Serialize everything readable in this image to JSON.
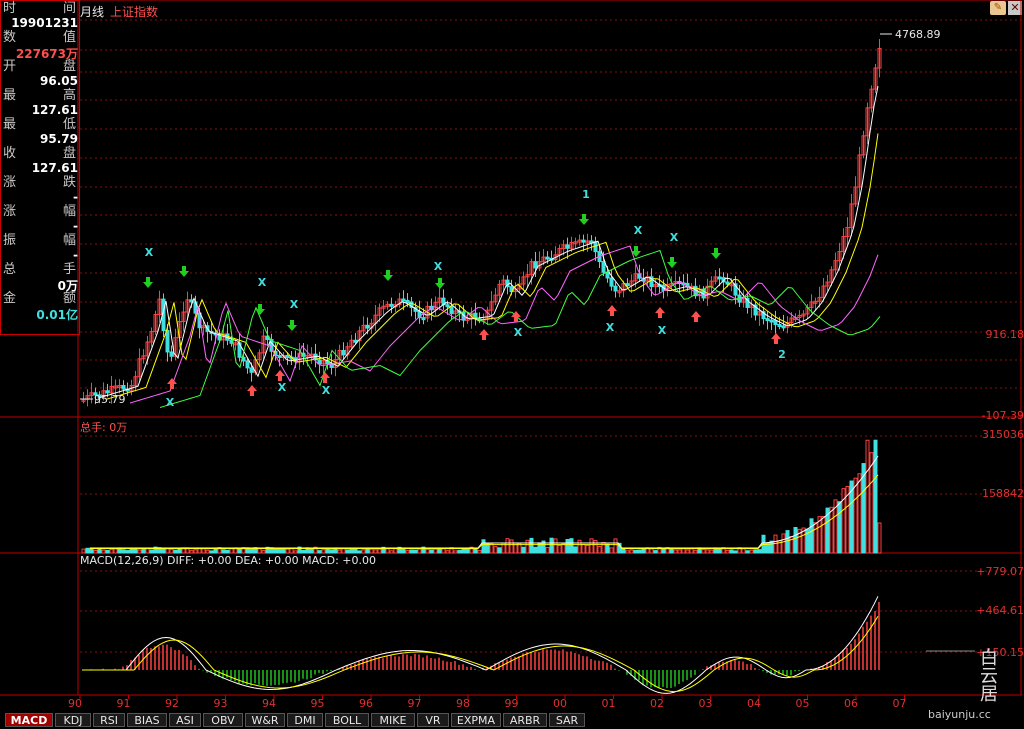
{
  "header": {
    "period": "月线",
    "index_name": "上证指数"
  },
  "info_panel": [
    {
      "left": "时",
      "right": "间",
      "value": "19901231"
    },
    {
      "left": "数",
      "right": "值",
      "value": "227673万",
      "value_color": "#ff5050"
    },
    {
      "left": "开",
      "right": "盘",
      "value": "96.05"
    },
    {
      "left": "最",
      "right": "高",
      "value": "127.61"
    },
    {
      "left": "最",
      "right": "低",
      "value": "95.79"
    },
    {
      "left": "收",
      "right": "盘",
      "value": "127.61"
    },
    {
      "left": "涨",
      "right": "跌",
      "value": "-"
    },
    {
      "left": "涨",
      "right": "幅",
      "value": "-"
    },
    {
      "left": "振",
      "right": "幅",
      "value": "-"
    },
    {
      "left": "总",
      "right": "手",
      "value": "0万"
    },
    {
      "left": "金",
      "right": "额",
      "value": "0.01亿"
    }
  ],
  "price_axis": {
    "high_label": "4768.89",
    "low_label": "95.79",
    "mid_label": "916.18",
    "bottom_label": "-107.39"
  },
  "volume_panel": {
    "title": "总手: 0万",
    "labels": [
      "315036",
      "158842"
    ]
  },
  "macd_panel": {
    "title": "MACD(12,26,9) DIFF: +0.00 DEA: +0.00 MACD: +0.00",
    "labels": [
      "+779.07",
      "+464.61",
      "+150.15"
    ]
  },
  "x_axis": [
    "90",
    "91",
    "92",
    "93",
    "94",
    "95",
    "96",
    "97",
    "98",
    "99",
    "00",
    "01",
    "02",
    "03",
    "04",
    "05",
    "06",
    "07"
  ],
  "annotations": {
    "cross": "X",
    "peak_label": "1",
    "trough_label": "2"
  },
  "tabs": [
    "MACD",
    "KDJ",
    "RSI",
    "BIAS",
    "ASI",
    "OBV",
    "W&R",
    "DMI",
    "BOLL",
    "MIKE",
    "VR",
    "EXPMA",
    "ARBR",
    "SAR"
  ],
  "watermark": {
    "text": "白云居",
    "url": "baiyunju.cc"
  },
  "colors": {
    "up": "#ff4040",
    "down": "#40e0e0",
    "grid": "#8a1010",
    "axis": "#e03030",
    "ma5": "#ffffff",
    "ma10": "#ffff00",
    "ma20": "#ff66ff",
    "ma60": "#40ff40"
  },
  "chart_data": {
    "type": "candlestick",
    "x": [
      "1990",
      "1991",
      "1992",
      "1993",
      "1994",
      "1995",
      "1996",
      "1997",
      "1998",
      "1999",
      "2000",
      "2001",
      "2002",
      "2003",
      "2004",
      "2005",
      "2006",
      "2007"
    ],
    "close": [
      127.61,
      292.75,
      780.39,
      833.8,
      647.87,
      555.29,
      917.02,
      1194.1,
      1146.7,
      1366.58,
      2073.48,
      1645.97,
      1357.65,
      1497.04,
      1266.5,
      1161.06,
      2675.47,
      4768.89
    ],
    "high": [
      127.61,
      292.75,
      1429.01,
      1558.95,
      1052.94,
      926.41,
      1258.69,
      1510.18,
      1422.98,
      1756.18,
      2125.72,
      2245.43,
      1748.89,
      1649.6,
      1783.01,
      1328.53,
      2698.9,
      4768.89
    ],
    "low": [
      95.79,
      105.77,
      292.76,
      750.46,
      325.89,
      524.43,
      512.83,
      870.18,
      1043.02,
      1047.83,
      1361.21,
      1514.86,
      1339.2,
      1307.4,
      1259.43,
      998.23,
      1161.91,
      2541.52
    ],
    "ylim": [
      -107.39,
      4768.89
    ]
  }
}
